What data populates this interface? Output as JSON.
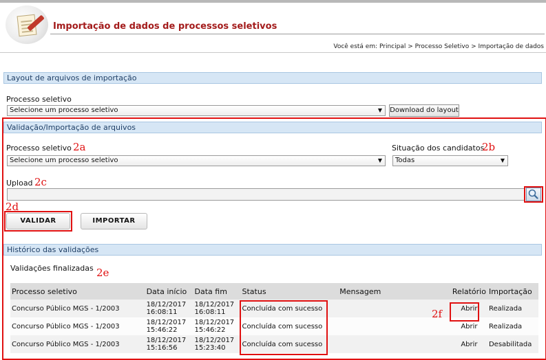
{
  "header": {
    "title": "Importação de dados de processos seletivos",
    "breadcrumb": "Você está em: Principal > Processo Seletivo > Importação de dados"
  },
  "layout_section": {
    "heading": "Layout de arquivos de importação",
    "process_label": "Processo seletivo",
    "process_select_value": "Selecione um processo seletivo",
    "download_button": "Download do layout"
  },
  "validation_section": {
    "heading": "Validação/Importação de arquivos",
    "process_label": "Processo seletivo",
    "process_select_value": "Selecione um processo seletivo",
    "situation_label": "Situação dos candidatos",
    "situation_select_value": "Todas",
    "upload_label": "Upload",
    "validate_button": "VALIDAR",
    "import_button": "IMPORTAR"
  },
  "history_section": {
    "heading": "Histórico das validações",
    "subheading": "Validações finalizadas",
    "columns": [
      "Processo seletivo",
      "Data início",
      "Data fim",
      "Status",
      "Mensagem",
      "Relatório",
      "Importação"
    ],
    "rows": [
      {
        "process": "Concurso Público MGS - 1/2003",
        "start": "18/12/2017 16:08:11",
        "end": "18/12/2017 16:08:11",
        "status": "Concluída com sucesso",
        "message": "",
        "report": "Abrir",
        "import": "Realizada"
      },
      {
        "process": "Concurso Público MGS - 1/2003",
        "start": "18/12/2017 15:46:22",
        "end": "18/12/2017 15:46:22",
        "status": "Concluída com sucesso",
        "message": "",
        "report": "Abrir",
        "import": "Realizada"
      },
      {
        "process": "Concurso Público MGS - 1/2003",
        "start": "18/12/2017 15:16:56",
        "end": "18/12/2017 15:23:40",
        "status": "Concluída com sucesso",
        "message": "",
        "report": "Abrir",
        "import": "Desabilitada"
      }
    ]
  },
  "annotations": {
    "a2a": "2a",
    "a2b": "2b",
    "a2c": "2c",
    "a2d": "2d",
    "a2e": "2e",
    "a2f": "2f"
  },
  "colors": {
    "title": "#a31b1b",
    "section_header_bg": "#d6e6f5",
    "annotation": "#e01010",
    "link_blue": "#34679a",
    "link_red": "#b02b2b"
  },
  "icons": [
    "app-logo-icon",
    "magnifier-icon",
    "dropdown-arrow-icon"
  ]
}
